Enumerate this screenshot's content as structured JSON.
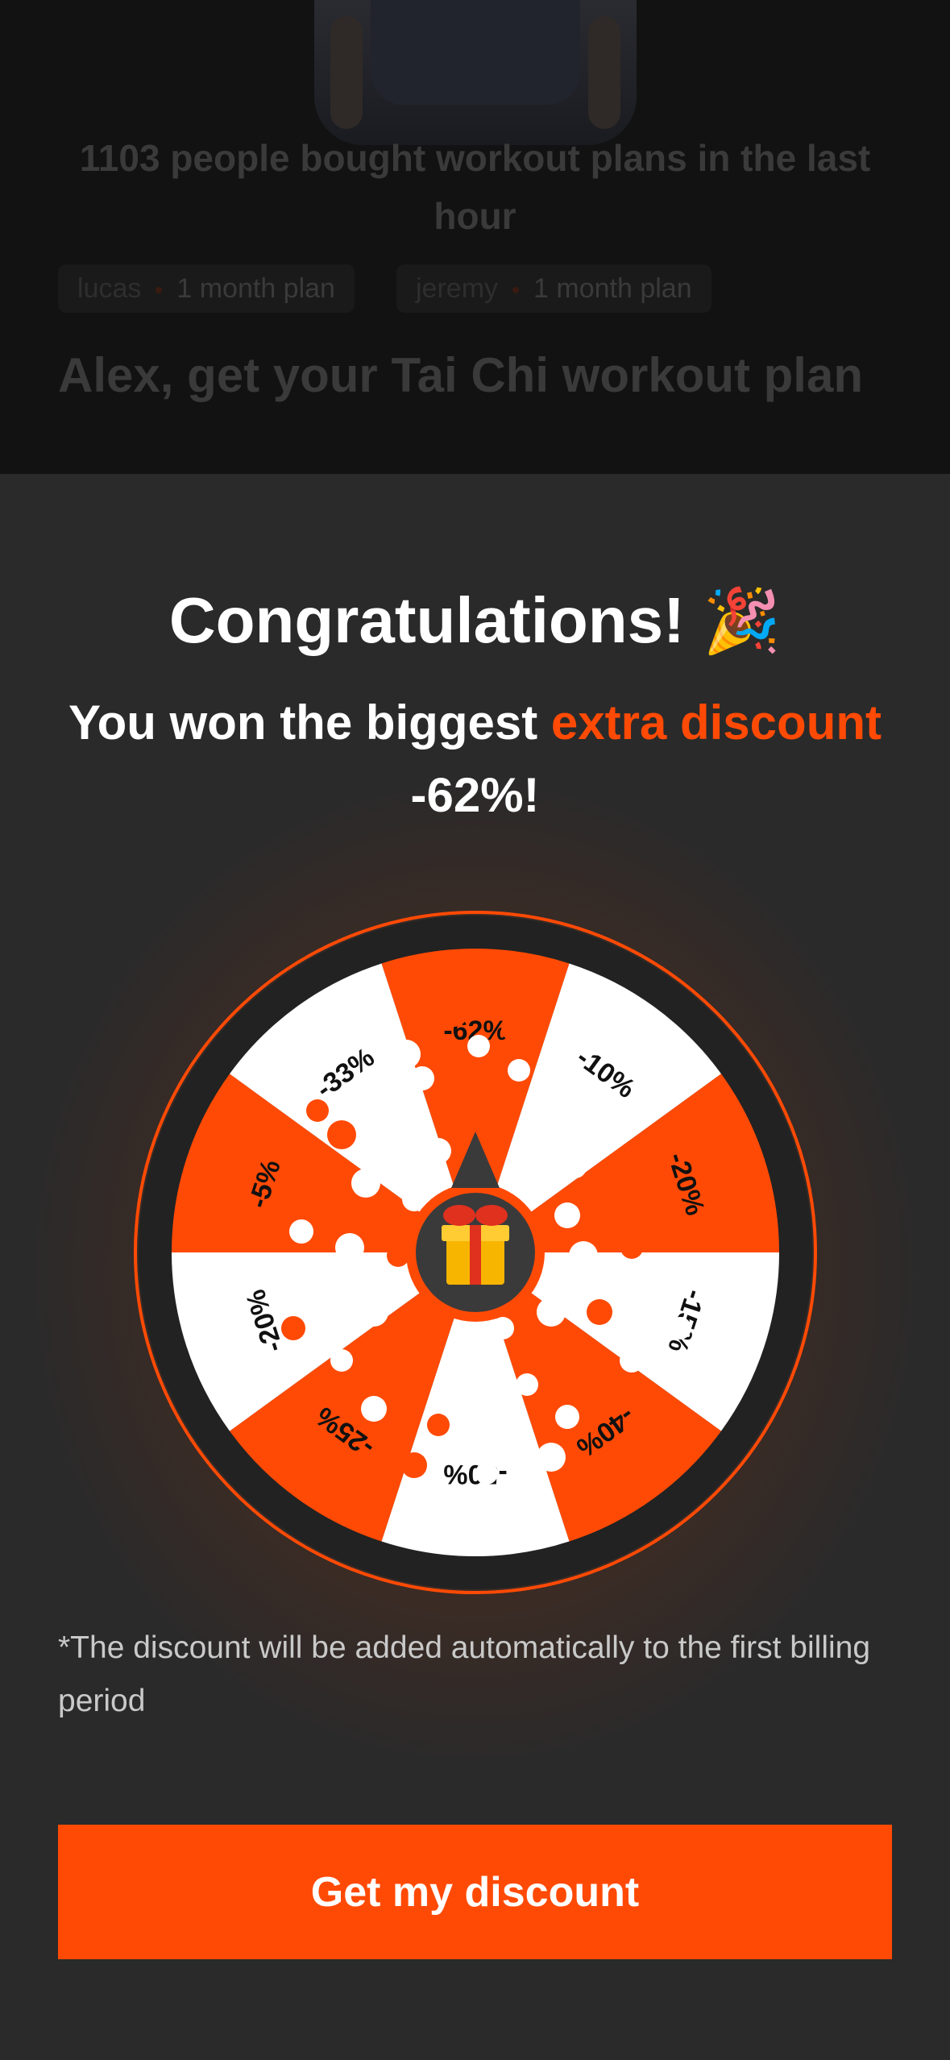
{
  "background": {
    "headline": "1103 people bought workout plans in the last hour",
    "chips": [
      {
        "name": "lucas",
        "plan": "1 month plan"
      },
      {
        "name": "jeremy",
        "plan": "1 month plan"
      }
    ],
    "title": "Alex, get your Tai Chi workout plan"
  },
  "modal": {
    "title": "Congratulations!",
    "title_emoji": "🎉",
    "message_prefix": "You won the biggest",
    "message_accent": "extra discount",
    "message_suffix": "-62%!",
    "footnote": "*The discount will be added automatically to the first billing period",
    "cta_label": "Get my discount"
  },
  "wheel": {
    "segments": [
      "-62%",
      "-10%",
      "-20%",
      "-15%",
      "-40%",
      "-50%",
      "-25%",
      "-20%",
      "-5%",
      "-33%"
    ],
    "center_icon": "gift-icon"
  },
  "colors": {
    "accent": "#ff4a05",
    "segment_light": "#ffffff",
    "wheel_rim": "#222222"
  }
}
